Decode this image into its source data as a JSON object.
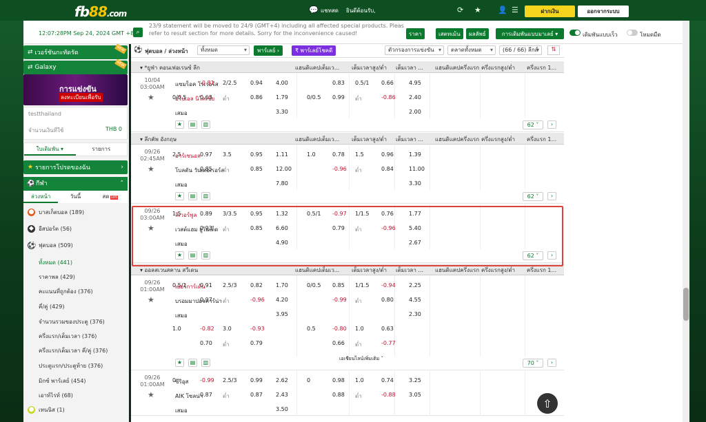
{
  "header": {
    "logo_a": "fb",
    "logo_b": "88",
    "logo_c": ".com",
    "greeting": "แชทสด",
    "welcome": "ยินดีต้อนรับ,",
    "balance": "ฝากเงิน",
    "logout": "ออกจากระบบ"
  },
  "subbar": {
    "time": "12:07:28PM Sep 24, 2024 GMT +8",
    "notice_line1": "23/9 statement will be moved to 24/9 (GMT+4) including all affected special products. Please",
    "notice_line2": "refer to result section for more details. Sorry for the inconvenience caused!",
    "results": "ราคา",
    "rules": "เสตทเม้น",
    "results2": "ผลลัพธ์",
    "bet_types": "การเดิมพันแบบมาเลย์",
    "toggle1": "เดิมพันแบบเร็ว",
    "toggle2": "โหมดมืด"
  },
  "sidebar": {
    "virtual": "เวอร์ชันกะทัดรัด",
    "galaxy": "Galaxy",
    "new1": "NEW",
    "new2": "NEW",
    "banner_t1": "การแข่งขัน",
    "banner_t2": "ลงทะเบียนเพื่อรับ",
    "user_label": "testthailand",
    "credit_label": "จำนวนเงินที่ใช้",
    "credit_value": "THB 0",
    "tab_bets": "ใบเดิมพัน",
    "tab_list": "รายการ",
    "favorites": "รายการโปรดของฉัน",
    "sports": "กีฬา",
    "sub_early": "ล่วงหน้า",
    "sub_today": "วันนี้",
    "sub_live": "สด",
    "live_count": "105",
    "sport_items": [
      {
        "name": "บาสเก็ตบอล",
        "count": "(189)"
      },
      {
        "name": "อีสปอร์ต",
        "count": "(56)"
      },
      {
        "name": "ฟุตบอล",
        "count": "(509)"
      }
    ],
    "league_links": [
      "ทั้งหมด (441)",
      "ราคาพล (429)",
      "คะแนนที่ถูกต้อง (376)",
      "คี่/คู่ (429)",
      "จำนวนรวมของประตู (376)",
      "ครึ่งแรก/เต็มเวลา (376)",
      "ครึ่งแรก/เต็มเวลา คี่/คู่ (376)",
      "ประตูแรก/ประตูท้าย (376)",
      "มิกซ์ พาร์เลย์ (454)",
      "เอาท์ไรท์ (68)"
    ],
    "tennis": "เทนนิส",
    "tennis_count": "(1)"
  },
  "filter": {
    "sport_title": "ฟุตบอล / ล่วงหน้า",
    "all": "ทั้งหมด",
    "parlay": "พาร์เลย์",
    "parlay_code": "พาร์เลย์โชคดี",
    "sort_by": "ตัวกรองการแข่งขัน",
    "market": "ตลาดทั้งหมด",
    "league_count": "(66 / 66) ลีกส์"
  },
  "columns": [
    "แฮนดิแคปเต็มเว...",
    "เต็มเวลาสูง/ต่ำ",
    "เต็มเวลา ...",
    "แฮนดิแคปครึ่งแรก",
    "ครึ่งแรกสูง/ต่ำ",
    "ครึ่งแรก 1..."
  ],
  "leagues": [
    {
      "name": "*ยูฟ่า คอนเฟอเรนซ์ ลีก",
      "matches": [
        {
          "date": "10/04",
          "time": "03:00AM",
          "home": "แซมร็อค โรเวอร์ส",
          "away": "อโปเอล นิโคเซีย",
          "draw": "เสมอ",
          "away_red": true,
          "r1": [
            "",
            "-0.81",
            "2/2.5",
            "0.94",
            "4.00",
            "",
            "0.83",
            "0.5/1",
            "0.66",
            "4.95"
          ],
          "r2": [
            "0/0.5",
            "0.63",
            "ต่ำ",
            "0.86",
            "1.79",
            "0/0.5",
            "0.99",
            "ต่ำ",
            "-0.86",
            "2.40"
          ],
          "r3": [
            "",
            "",
            "",
            "",
            "3.30",
            "",
            "",
            "",
            "",
            "2.00"
          ],
          "more": "62"
        }
      ]
    },
    {
      "name": "ลีกคัพ อังกฤษ",
      "matches": [
        {
          "date": "09/26",
          "time": "02:45AM",
          "home": "อาร์เซนอล",
          "away": "โบลตัน วันเดอเรอร์ส",
          "draw": "เสมอ",
          "home_red": true,
          "r1": [
            "2.5",
            "0.97",
            "3.5",
            "0.95",
            "1.11",
            "1.0",
            "0.78",
            "1.5",
            "0.96",
            "1.39"
          ],
          "r2": [
            "",
            "0.85",
            "ต่ำ",
            "0.85",
            "12.00",
            "",
            "-0.96",
            "ต่ำ",
            "0.84",
            "11.00"
          ],
          "r3": [
            "",
            "",
            "",
            "",
            "7.80",
            "",
            "",
            "",
            "",
            "3.30"
          ],
          "more": "62"
        },
        {
          "date": "09/26",
          "time": "03:00AM",
          "home": "ลิเวอร์พูล",
          "away": "เวสต์แฮม ยูไนเต็ด",
          "draw": "เสมอ",
          "home_red": true,
          "r1": [
            "1.5",
            "0.89",
            "3/3.5",
            "0.95",
            "1.32",
            "0.5/1",
            "-0.97",
            "1/1.5",
            "0.76",
            "1.77"
          ],
          "r2": [
            "",
            "0.93",
            "ต่ำ",
            "0.85",
            "6.60",
            "",
            "0.79",
            "ต่ำ",
            "-0.96",
            "5.40"
          ],
          "r3": [
            "",
            "",
            "",
            "",
            "4.90",
            "",
            "",
            "",
            "",
            "2.67"
          ],
          "more": "62"
        }
      ]
    },
    {
      "name": "ออลสเวนสคาน สวีเดน",
      "matches": [
        {
          "date": "09/26",
          "time": "01:00AM",
          "home": "เยอร์การ์เด้น",
          "away": "บรอมมาปอจคาร์น่า",
          "draw": "เสมอ",
          "home_red": true,
          "r1": [
            "0.5/1",
            "0.91",
            "2.5/3",
            "0.82",
            "1.70",
            "0/0.5",
            "0.85",
            "1/1.5",
            "-0.94",
            "2.25"
          ],
          "r2": [
            "",
            "0.97",
            "ต่ำ",
            "-0.96",
            "4.20",
            "",
            "-0.99",
            "ต่ำ",
            "0.80",
            "4.55"
          ],
          "r3": [
            "",
            "",
            "",
            "",
            "3.95",
            "",
            "",
            "",
            "",
            "2.30"
          ],
          "r4": [
            "1.0",
            "-0.82",
            "3.0",
            "-0.93",
            "",
            "0.5",
            "-0.80",
            "1.0",
            "0.63",
            ""
          ],
          "r5": [
            "",
            "0.70",
            "ต่ำ",
            "0.79",
            "",
            "",
            "0.66",
            "ต่ำ",
            "-0.77",
            ""
          ],
          "more": "70",
          "show_more": "เอเชียนไลน์เพิ่มเติม"
        },
        {
          "date": "09/26",
          "time": "01:00AM",
          "home": "ซีริอุส",
          "away": "AIK โซลน่า",
          "draw": "เสมอ",
          "r1": [
            "0",
            "-0.99",
            "2.5/3",
            "0.99",
            "2.62",
            "0",
            "0.98",
            "1.0",
            "0.74",
            "3.25"
          ],
          "r2": [
            "",
            "0.87",
            "ต่ำ",
            "0.87",
            "2.43",
            "",
            "0.88",
            "ต่ำ",
            "-0.88",
            "3.05"
          ],
          "r3": [
            "",
            "",
            "",
            "",
            "3.50",
            "",
            "",
            "",
            "",
            ""
          ],
          "more": ""
        }
      ]
    }
  ],
  "colors": {
    "brand": "#0b7a2e",
    "highlight": "#e0403a",
    "negative": "#c8102e",
    "accent": "#f7d51d"
  }
}
